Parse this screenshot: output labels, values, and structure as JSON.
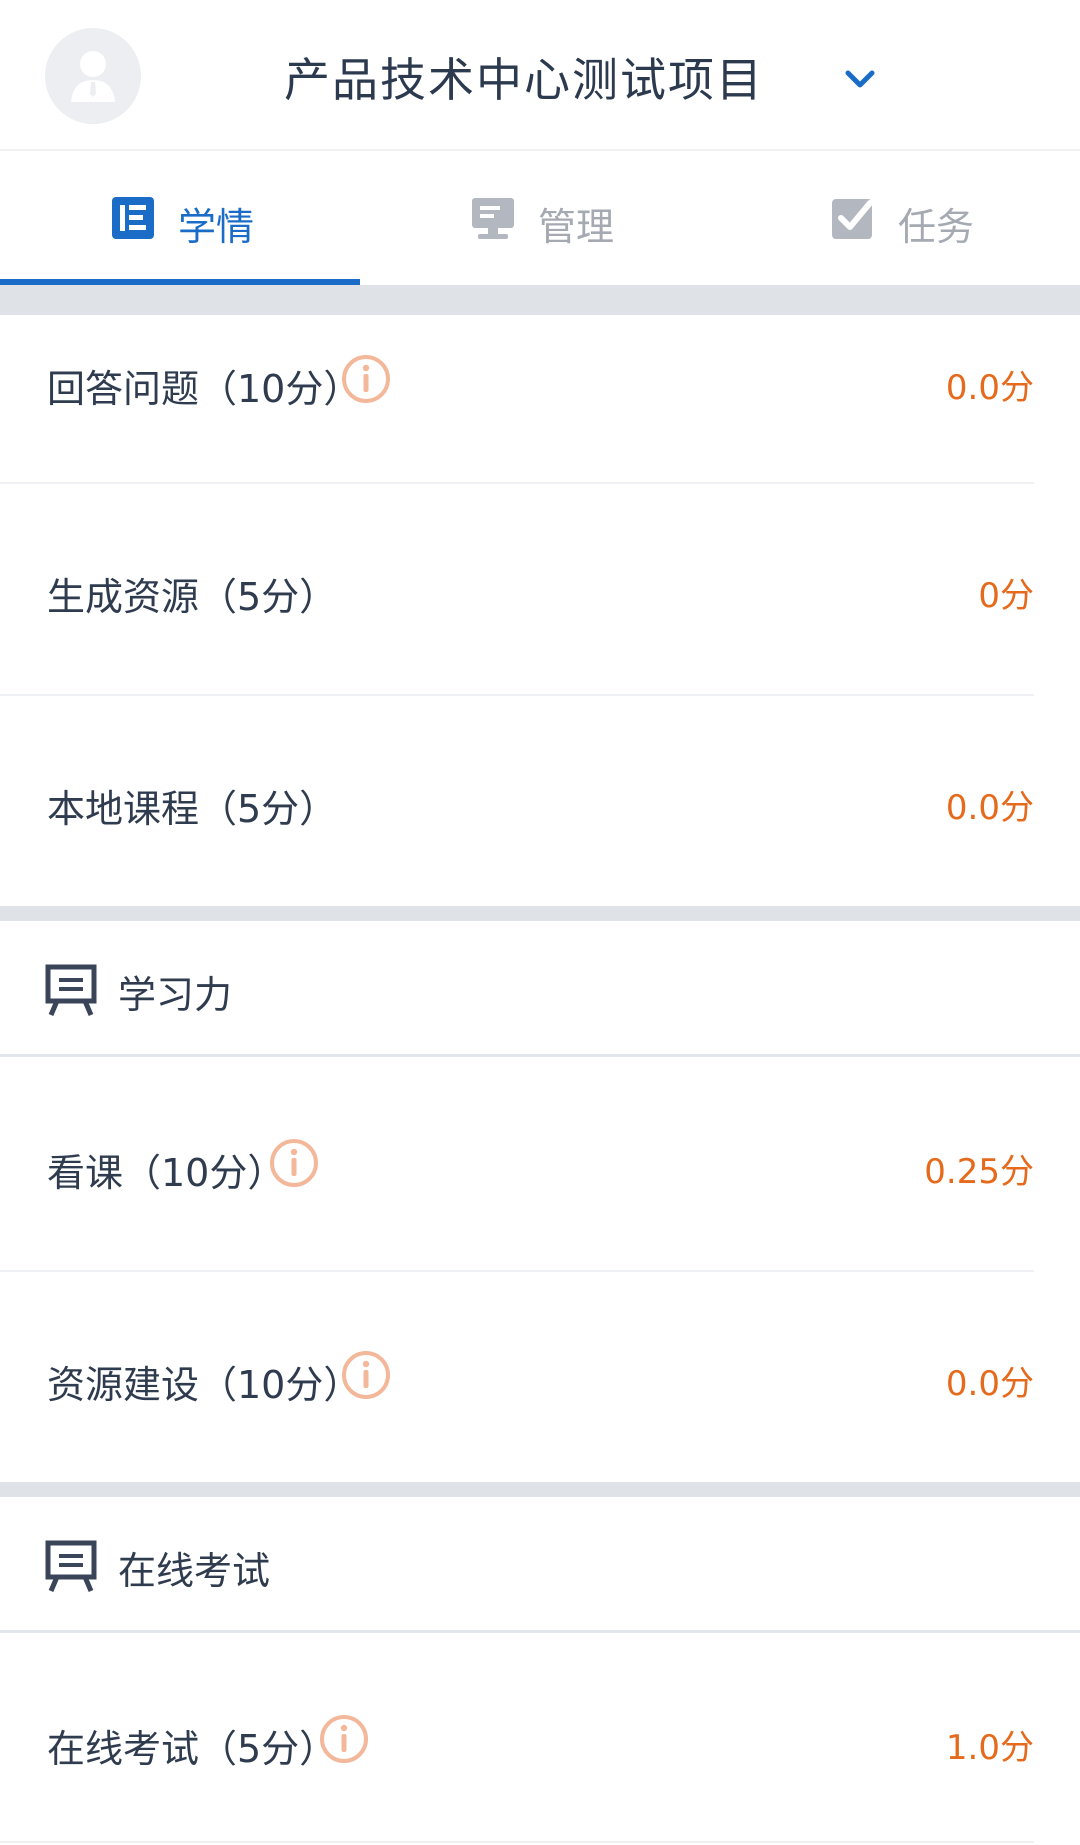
{
  "header": {
    "title": "产品技术中心测试项目",
    "avatar_icon": "user-avatar-icon",
    "dropdown_icon": "chevron-down-icon",
    "accent": "#1a6cc7"
  },
  "tabs": [
    {
      "label": "学情",
      "icon": "report-icon",
      "active": true
    },
    {
      "label": "管理",
      "icon": "monitor-icon",
      "active": false
    },
    {
      "label": "任务",
      "icon": "checkbox-icon",
      "active": false
    }
  ],
  "group1": {
    "rows": [
      {
        "label": "回答问题（10分）",
        "score": "0.0分",
        "has_info": true
      },
      {
        "label": "生成资源（5分）",
        "score": "0分",
        "has_info": false
      },
      {
        "label": "本地课程（5分）",
        "score": "0.0分",
        "has_info": false
      }
    ]
  },
  "section_learning": {
    "title": "学习力",
    "icon": "presentation-board-icon",
    "rows": [
      {
        "label": "看课（10分）",
        "score": "0.25分",
        "has_info": true
      },
      {
        "label": "资源建设（10分）",
        "score": "0.0分",
        "has_info": true
      }
    ]
  },
  "section_exam": {
    "title": "在线考试",
    "icon": "presentation-board-icon",
    "rows": [
      {
        "label": "在线考试（5分）",
        "score": "1.0分",
        "has_info": true
      }
    ]
  },
  "colors": {
    "score": "#e56a1c",
    "info_icon": "#f3b79a",
    "divider": "#dfe2e6"
  }
}
